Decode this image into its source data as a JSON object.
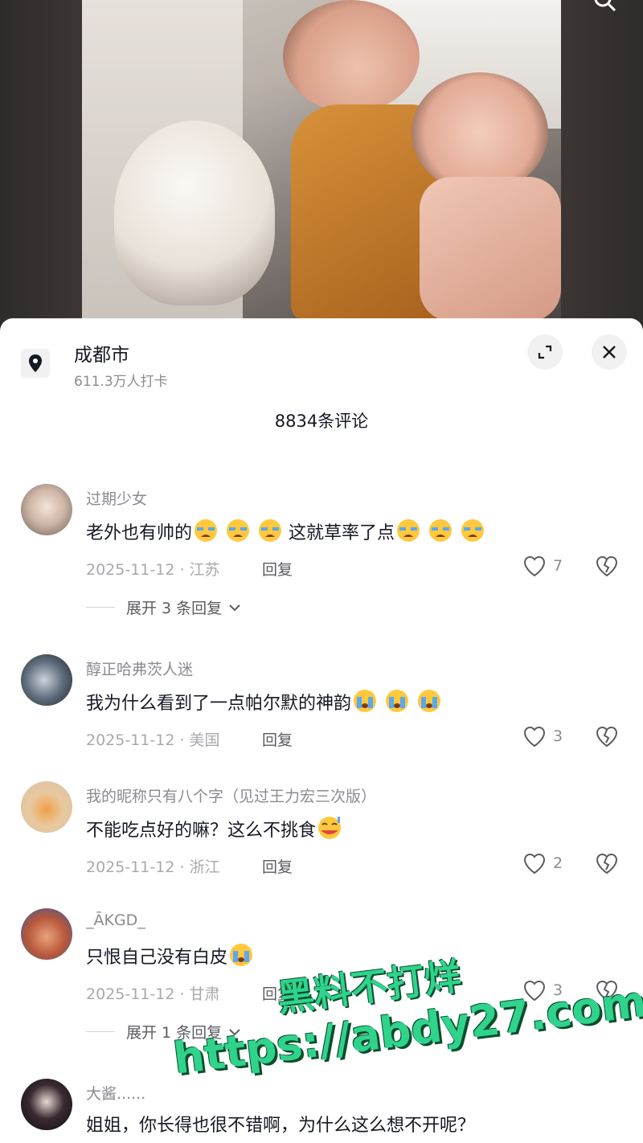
{
  "location": {
    "title": "成都市",
    "checkins": "611.3万人打卡"
  },
  "comments_header": "8834条评论",
  "comments": [
    {
      "username": "过期少女",
      "text": "老外也有帅的",
      "text_after": "这就草率了点",
      "date_region": "2025-11-12 · 江苏",
      "reply": "回复",
      "likes": "7",
      "expand": "展开 3 条回复"
    },
    {
      "username": "醇正哈弗茨人迷",
      "text": "我为什么看到了一点帕尔默的神韵",
      "date_region": "2025-11-12 · 美国",
      "reply": "回复",
      "likes": "3"
    },
    {
      "username": "我的昵称只有八个字（见过王力宏三次版）",
      "text": "不能吃点好的嘛？这么不挑食",
      "date_region": "2025-11-12 · 浙江",
      "reply": "回复",
      "likes": "2"
    },
    {
      "username": "_ĀKGD_",
      "text": "只恨自己没有白皮",
      "date_region": "2025-11-12 · 甘肃",
      "reply": "回复",
      "likes": "3",
      "expand": "展开 1 条回复"
    },
    {
      "username": "大酱......",
      "text": "姐姐，你长得也很不错啊，为什么这么想不开呢？"
    }
  ],
  "watermark": {
    "line1": "黑料不打烊",
    "line2": "https://abdy27.com"
  }
}
